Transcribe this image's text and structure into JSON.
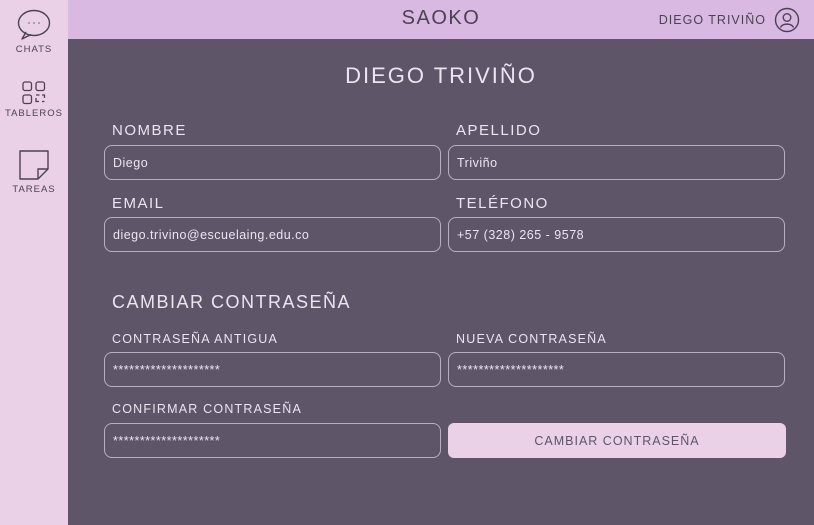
{
  "sidebar": {
    "items": [
      {
        "label": "CHATS",
        "icon": "chat-bubble-icon"
      },
      {
        "label": "TABLEROS",
        "icon": "boards-grid-icon"
      },
      {
        "label": "TAREAS",
        "icon": "sticky-note-icon"
      }
    ]
  },
  "header": {
    "title": "SAOKO",
    "user_name": "DIEGO TRIVIÑO",
    "user_icon": "user-avatar-icon"
  },
  "profile": {
    "title": "DIEGO TRIVIÑO",
    "fields": {
      "nombre": {
        "label": "NOMBRE",
        "value": "Diego"
      },
      "apellido": {
        "label": "APELLIDO",
        "value": "Triviño"
      },
      "email": {
        "label": "EMAIL",
        "value": "diego.trivino@escuelaing.edu.co"
      },
      "telefono": {
        "label": "TELÉFONO",
        "value": "+57 (328) 265 - 9578"
      }
    }
  },
  "password": {
    "title": "CAMBIAR CONTRASEÑA",
    "old": {
      "label": "CONTRASEÑA ANTIGUA",
      "value": "********************"
    },
    "new": {
      "label": "NUEVA CONTRASEÑA",
      "value": "********************"
    },
    "confirm": {
      "label": "CONFIRMAR CONTRASEÑA",
      "value": "********************"
    },
    "button_label": "CAMBIAR CONTRASEÑA"
  },
  "colors": {
    "sidebar": "#ead1e8",
    "topbar": "#d9b9e1",
    "background": "#5e5569",
    "text_light": "#ece4f1",
    "text_dark": "#4a4352"
  }
}
